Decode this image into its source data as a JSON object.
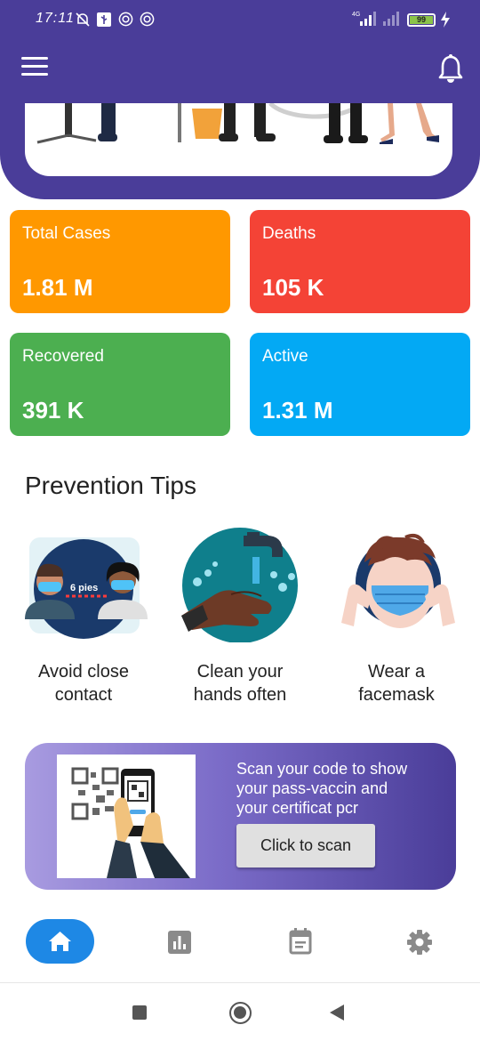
{
  "status_bar": {
    "time": "17:11",
    "battery": "99",
    "network_label": "4G",
    "icons": [
      "mute-icon",
      "usb-icon",
      "sync-icon",
      "sync-icon",
      "signal-icon",
      "signal-icon",
      "battery-icon",
      "charging-icon"
    ]
  },
  "header": {
    "menu_icon": "hamburger-icon",
    "notification_icon": "bell-icon",
    "background_color": "#4a3d99"
  },
  "stats": [
    {
      "label": "Total Cases",
      "value": "1.81 M",
      "color": "#ff9800"
    },
    {
      "label": "Deaths",
      "value": "105 K",
      "color": "#f44336"
    },
    {
      "label": "Recovered",
      "value": "391 K",
      "color": "#4caf50"
    },
    {
      "label": "Active",
      "value": "1.31 M",
      "color": "#03a9f4"
    }
  ],
  "prevention": {
    "title": "Prevention Tips",
    "tips": [
      {
        "line1": "Avoid close",
        "line2": "contact",
        "badge": "6 pies"
      },
      {
        "line1": "Clean your",
        "line2": "hands often"
      },
      {
        "line1": "Wear a",
        "line2": "facemask"
      }
    ]
  },
  "scan": {
    "line1": "Scan your code to show",
    "line2": "your pass-vaccin and",
    "line3": "your certificat pcr",
    "button_label": "Click to scan"
  },
  "bottom_nav": {
    "items": [
      "home-icon",
      "bar-chart-icon",
      "calendar-icon",
      "settings-icon"
    ],
    "active": "home-icon",
    "active_color": "#1e88e5"
  },
  "system_nav": {
    "items": [
      "recents-square-icon",
      "home-circle-icon",
      "back-triangle-icon"
    ]
  }
}
